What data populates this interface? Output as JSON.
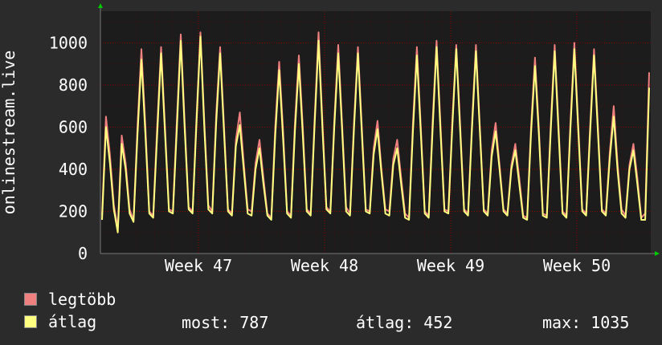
{
  "chart_data": {
    "type": "line",
    "ylabel": "onlinestream.live",
    "ylim": [
      0,
      1150
    ],
    "yticks": [
      0,
      200,
      400,
      600,
      800,
      1000
    ],
    "x_tick_labels": [
      "Week 47",
      "Week 48",
      "Week 49",
      "Week 50"
    ],
    "grid": true,
    "colors": {
      "background": "#2b2b2b",
      "plot": "#1c1c1c",
      "grid": "#8b0000",
      "max": "#f08080",
      "avg": "#ffff80",
      "axis": "#777777",
      "arrow": "#00cc00"
    },
    "series": [
      {
        "name": "legtöbb",
        "values": [
          180,
          650,
          470,
          230,
          120,
          560,
          430,
          210,
          160,
          600,
          970,
          610,
          200,
          180,
          600,
          980,
          600,
          210,
          200,
          630,
          1040,
          620,
          220,
          200,
          650,
          1050,
          620,
          230,
          200,
          660,
          980,
          600,
          210,
          190,
          540,
          670,
          430,
          210,
          200,
          430,
          540,
          360,
          190,
          170,
          600,
          910,
          580,
          200,
          180,
          620,
          940,
          600,
          210,
          190,
          640,
          1050,
          620,
          220,
          200,
          630,
          990,
          610,
          220,
          190,
          620,
          980,
          600,
          210,
          200,
          500,
          630,
          400,
          210,
          200,
          450,
          540,
          360,
          190,
          170,
          620,
          980,
          600,
          200,
          180,
          630,
          1010,
          610,
          210,
          200,
          630,
          990,
          610,
          210,
          190,
          620,
          990,
          600,
          210,
          190,
          490,
          620,
          420,
          210,
          190,
          420,
          520,
          360,
          180,
          170,
          600,
          930,
          590,
          190,
          180,
          610,
          990,
          600,
          200,
          180,
          620,
          1000,
          610,
          210,
          190,
          600,
          970,
          600,
          210,
          190,
          480,
          700,
          420,
          210,
          180,
          420,
          520,
          360,
          170,
          190,
          860
        ]
      },
      {
        "name": "átlag",
        "values": [
          160,
          600,
          430,
          210,
          100,
          520,
          400,
          190,
          150,
          560,
          920,
          570,
          190,
          170,
          560,
          950,
          570,
          200,
          190,
          590,
          1010,
          590,
          210,
          190,
          620,
          1030,
          590,
          210,
          190,
          620,
          950,
          570,
          200,
          180,
          510,
          610,
          400,
          190,
          180,
          400,
          500,
          330,
          180,
          160,
          560,
          870,
          540,
          190,
          170,
          580,
          900,
          560,
          200,
          180,
          610,
          1010,
          590,
          210,
          190,
          600,
          950,
          580,
          200,
          180,
          590,
          950,
          570,
          200,
          190,
          470,
          590,
          380,
          190,
          180,
          420,
          500,
          330,
          170,
          160,
          580,
          940,
          570,
          190,
          170,
          590,
          980,
          580,
          200,
          190,
          600,
          970,
          580,
          200,
          180,
          590,
          960,
          580,
          200,
          180,
          460,
          580,
          400,
          200,
          180,
          400,
          490,
          330,
          170,
          160,
          570,
          890,
          560,
          180,
          170,
          580,
          960,
          570,
          190,
          170,
          590,
          970,
          580,
          200,
          180,
          570,
          940,
          570,
          200,
          180,
          450,
          650,
          390,
          190,
          170,
          400,
          490,
          330,
          160,
          160,
          787
        ]
      }
    ],
    "stats": {
      "most_label": "most:",
      "most": "787",
      "avg_label": "átlag:",
      "avg": "452",
      "max_label": "max:",
      "max": "1035"
    }
  }
}
